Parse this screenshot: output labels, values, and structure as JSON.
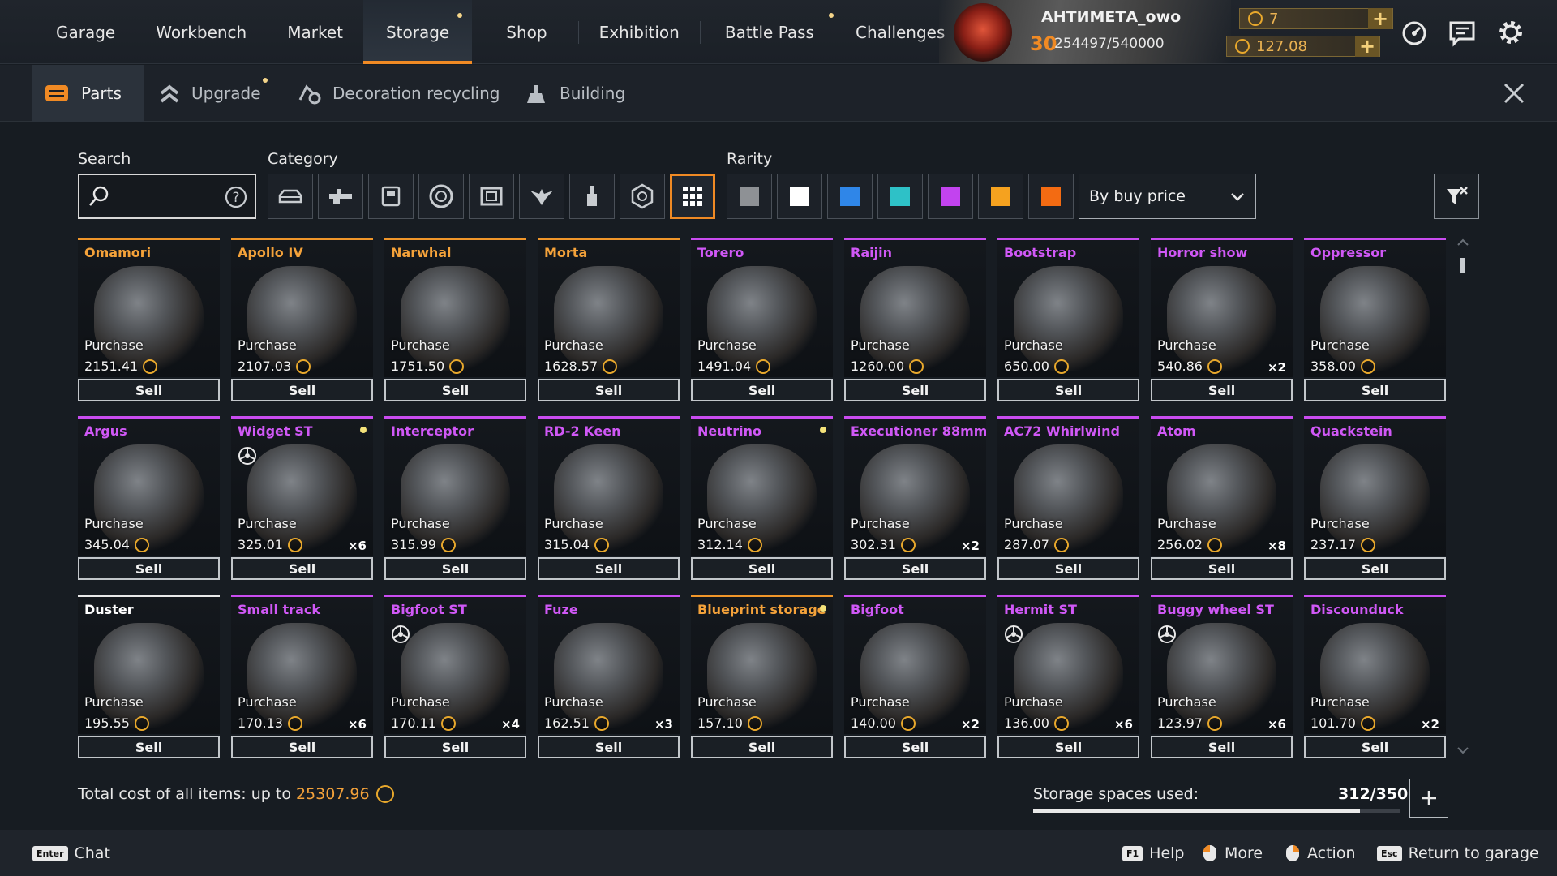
{
  "nav": {
    "items": [
      "Garage",
      "Workbench",
      "Market",
      "Storage",
      "Shop",
      "Exhibition",
      "Battle Pass",
      "Challenges"
    ],
    "active": "Storage"
  },
  "profile": {
    "name": "АНТИМЕТА_owo",
    "level": "30",
    "xp": "254497/540000"
  },
  "currency": {
    "primary": "7",
    "secondary": "127.08"
  },
  "subtabs": {
    "parts": "Parts",
    "upgrade": "Upgrade",
    "decoration": "Decoration recycling",
    "building": "Building"
  },
  "filters": {
    "search_label": "Search",
    "search_placeholder": "",
    "category_label": "Category",
    "rarity_label": "Rarity",
    "sort": "By buy price",
    "categories": [
      "cabins",
      "weapons",
      "modules",
      "wheels",
      "frames",
      "decor",
      "paints",
      "hardware",
      "all"
    ],
    "active_category": "all",
    "rarity_colors": [
      "#8e9195",
      "#ffffff",
      "#2f86e8",
      "#2ec1c7",
      "#c243ef",
      "#f5a21f",
      "#f36b12"
    ]
  },
  "common": {
    "purchase_label": "Purchase",
    "sell_label": "Sell"
  },
  "items": [
    {
      "name": "Omamori",
      "price": "2151.41",
      "qty": "",
      "rarity": "legendary",
      "dot": false,
      "wheel": false
    },
    {
      "name": "Apollo IV",
      "price": "2107.03",
      "qty": "",
      "rarity": "legendary",
      "dot": false,
      "wheel": false
    },
    {
      "name": "Narwhal",
      "price": "1751.50",
      "qty": "",
      "rarity": "legendary",
      "dot": false,
      "wheel": false
    },
    {
      "name": "Morta",
      "price": "1628.57",
      "qty": "",
      "rarity": "legendary",
      "dot": false,
      "wheel": false
    },
    {
      "name": "Torero",
      "price": "1491.04",
      "qty": "",
      "rarity": "epic",
      "dot": false,
      "wheel": false
    },
    {
      "name": "Raijin",
      "price": "1260.00",
      "qty": "",
      "rarity": "epic",
      "dot": false,
      "wheel": false
    },
    {
      "name": "Bootstrap",
      "price": "650.00",
      "qty": "",
      "rarity": "epic",
      "dot": false,
      "wheel": false
    },
    {
      "name": "Horror show",
      "price": "540.86",
      "qty": "×2",
      "rarity": "epic",
      "dot": false,
      "wheel": false
    },
    {
      "name": "Oppressor",
      "price": "358.00",
      "qty": "",
      "rarity": "epic",
      "dot": false,
      "wheel": false
    },
    {
      "name": "Argus",
      "price": "345.04",
      "qty": "",
      "rarity": "epic",
      "dot": false,
      "wheel": false
    },
    {
      "name": "Widget ST",
      "price": "325.01",
      "qty": "×6",
      "rarity": "epic",
      "dot": true,
      "wheel": true
    },
    {
      "name": "Interceptor",
      "price": "315.99",
      "qty": "",
      "rarity": "epic",
      "dot": false,
      "wheel": false
    },
    {
      "name": "RD-2 Keen",
      "price": "315.04",
      "qty": "",
      "rarity": "epic",
      "dot": false,
      "wheel": false
    },
    {
      "name": "Neutrino",
      "price": "312.14",
      "qty": "",
      "rarity": "epic",
      "dot": true,
      "wheel": false
    },
    {
      "name": "Executioner 88mm",
      "price": "302.31",
      "qty": "×2",
      "rarity": "epic",
      "dot": false,
      "wheel": false
    },
    {
      "name": "AC72 Whirlwind",
      "price": "287.07",
      "qty": "",
      "rarity": "epic",
      "dot": false,
      "wheel": false
    },
    {
      "name": "Atom",
      "price": "256.02",
      "qty": "×8",
      "rarity": "epic",
      "dot": false,
      "wheel": false
    },
    {
      "name": "Quackstein",
      "price": "237.17",
      "qty": "",
      "rarity": "epic",
      "dot": false,
      "wheel": false
    },
    {
      "name": "Duster",
      "price": "195.55",
      "qty": "",
      "rarity": "common",
      "dot": false,
      "wheel": false
    },
    {
      "name": "Small track",
      "price": "170.13",
      "qty": "×6",
      "rarity": "epic",
      "dot": false,
      "wheel": false
    },
    {
      "name": "Bigfoot ST",
      "price": "170.11",
      "qty": "×4",
      "rarity": "epic",
      "dot": false,
      "wheel": true
    },
    {
      "name": "Fuze",
      "price": "162.51",
      "qty": "×3",
      "rarity": "epic",
      "dot": false,
      "wheel": false
    },
    {
      "name": "Blueprint storage",
      "price": "157.10",
      "qty": "",
      "rarity": "legendary",
      "dot": true,
      "wheel": false
    },
    {
      "name": "Bigfoot",
      "price": "140.00",
      "qty": "×2",
      "rarity": "epic",
      "dot": false,
      "wheel": false
    },
    {
      "name": "Hermit ST",
      "price": "136.00",
      "qty": "×6",
      "rarity": "epic",
      "dot": false,
      "wheel": true
    },
    {
      "name": "Buggy wheel ST",
      "price": "123.97",
      "qty": "×6",
      "rarity": "epic",
      "dot": false,
      "wheel": true
    },
    {
      "name": "Discounduck",
      "price": "101.70",
      "qty": "×2",
      "rarity": "epic",
      "dot": false,
      "wheel": false
    }
  ],
  "summary": {
    "total_label": "Total cost of all items: up to",
    "total_value": "25307.96",
    "storage_label": "Storage spaces used:",
    "storage_count": "312/350",
    "storage_used": 312,
    "storage_capacity": 350
  },
  "footer": {
    "chat_key": "Enter",
    "chat": "Chat",
    "help_key": "F1",
    "help": "Help",
    "more": "More",
    "action": "Action",
    "return_key": "Esc",
    "return": "Return to garage"
  }
}
